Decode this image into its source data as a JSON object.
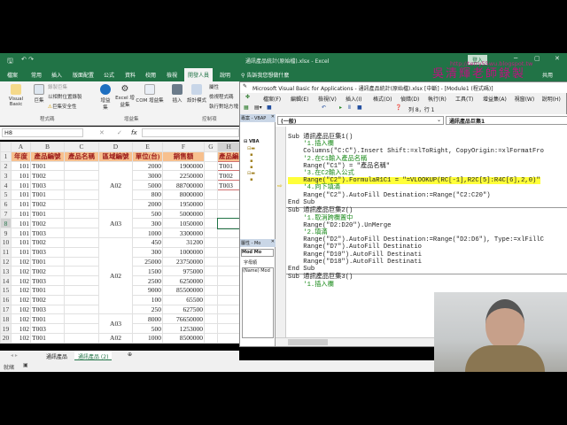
{
  "excel": {
    "title": "通訊產品統計(原始檔).xlsx - Excel",
    "signin": "登入",
    "share": "共用",
    "tabs": [
      "檔案",
      "常用",
      "插入",
      "版面配置",
      "公式",
      "資料",
      "校閱",
      "檢視",
      "開發人員",
      "說明"
    ],
    "active_tab": "開發人員",
    "tell_me": "告訴我您想做什麼",
    "ribbon": {
      "visual_basic": "Visual Basic",
      "macros": "巨集",
      "record_macro": "錄製巨集",
      "relative_ref": "以相對位置錄製",
      "macro_security": "巨集安全性",
      "group_code": "程式碼",
      "addins": "增益集",
      "excel_addins": "Excel 增益集",
      "com_addins": "COM 增益集",
      "group_addins": "增益集",
      "insert": "插入",
      "design_mode": "設計模式",
      "properties": "屬性",
      "view_code": "檢視程式碼",
      "run_dialog": "執行對話方塊",
      "group_controls": "控制項"
    },
    "name_box": "H8",
    "fx": "fx",
    "columns": [
      "A",
      "B",
      "C",
      "D",
      "E",
      "F",
      "G",
      "H"
    ],
    "headers": [
      "年度",
      "產品編號",
      "產品名稱",
      "區域編號",
      "單位(台)",
      "銷售額",
      "",
      "產品編"
    ],
    "rows": [
      [
        "101",
        "T001",
        "",
        2000,
        1900000,
        "T001"
      ],
      [
        "101",
        "T002",
        "",
        3000,
        2250000,
        "T002"
      ],
      [
        "101",
        "T003",
        "",
        5000,
        88700000,
        "T003"
      ],
      [
        "101",
        "T001",
        "",
        800,
        8000000,
        ""
      ],
      [
        "101",
        "T002",
        "",
        2000,
        1950000,
        ""
      ],
      [
        "101",
        "T001",
        "",
        500,
        5000000,
        ""
      ],
      [
        "101",
        "T002",
        "",
        300,
        1050000,
        ""
      ],
      [
        "101",
        "T003",
        "",
        1000,
        3300000,
        ""
      ],
      [
        "101",
        "T002",
        "",
        450,
        31200,
        ""
      ],
      [
        "101",
        "T003",
        "",
        300,
        1000000,
        ""
      ],
      [
        "102",
        "T001",
        "",
        25000,
        23750000,
        ""
      ],
      [
        "102",
        "T002",
        "",
        1500,
        975000,
        ""
      ],
      [
        "102",
        "T003",
        "",
        2500,
        6250000,
        ""
      ],
      [
        "102",
        "T001",
        "",
        9000,
        85500000,
        ""
      ],
      [
        "102",
        "T002",
        "",
        100,
        65500,
        ""
      ],
      [
        "102",
        "T003",
        "",
        250,
        627500,
        ""
      ],
      [
        "102",
        "T001",
        "",
        8000,
        76650000,
        ""
      ],
      [
        "102",
        "T003",
        "",
        500,
        1253000,
        ""
      ],
      [
        "102",
        "T001",
        "",
        1000,
        8500000,
        ""
      ]
    ],
    "regions": [
      {
        "label": "A02",
        "span": 5
      },
      {
        "label": "A03",
        "span": 3
      },
      {
        "label": "A02",
        "span": 8
      },
      {
        "label": "A03",
        "span": 2
      },
      {
        "label": "A02",
        "span": 1
      }
    ],
    "sheets": [
      "通訊產品",
      "通訊產品 (2)"
    ],
    "active_sheet": "通訊產品 (2)",
    "status": "就緒"
  },
  "vbe": {
    "title": "Microsoft Visual Basic for Applications - 通訊產品統計(原始檔).xlsx [中斷] - [Module1 (程式碼)]",
    "menu": [
      "檔案(F)",
      "編輯(E)",
      "檢視(V)",
      "插入(I)",
      "格式(O)",
      "偵錯(D)",
      "執行(R)",
      "工具(T)",
      "增益集(A)",
      "視窗(W)",
      "說明(H)"
    ],
    "position": "列 8，行 1",
    "object_combo": "(一般)",
    "proc_combo": "通訊產品巨集1",
    "project_title": "專案 - VBAP",
    "project_root": "VBA",
    "props_title": "屬性 - Mo",
    "props_combo": "Mod Mo",
    "props_tab": "字母順",
    "props_name": "(Name) Mod",
    "code": [
      {
        "t": "Sub 通訊產品巨集1()",
        "c": ""
      },
      {
        "t": "    '1.插入欄",
        "c": "cm"
      },
      {
        "t": "    Columns(\"C:C\").Insert Shift:=xlToRight, CopyOrigin:=xlFormatFro",
        "c": ""
      },
      {
        "t": "    '2.在C1輸入產品名稱",
        "c": "cm"
      },
      {
        "t": "    Range(\"C1\") = \"產品名稱\"",
        "c": ""
      },
      {
        "t": "    '3.在C2輸入公式",
        "c": "cm"
      },
      {
        "t": "    Range(\"C2\").FormulaR1C1 = \"=VLOOKUP(RC[-1],R2C[5]:R4C[6],2,0)\"",
        "c": "hl"
      },
      {
        "t": "    '4.向下填滿",
        "c": "cm"
      },
      {
        "t": "    Range(\"C2\").AutoFill Destination:=Range(\"C2:C20\")",
        "c": ""
      },
      {
        "t": "End Sub",
        "c": ""
      },
      {
        "t": "Sub 通訊產品巨集2()",
        "c": ""
      },
      {
        "t": "    '1.取消跨欄置中",
        "c": "cm"
      },
      {
        "t": "    Range(\"D2:D20\").UnMerge",
        "c": ""
      },
      {
        "t": "    '2.填滿",
        "c": "cm"
      },
      {
        "t": "    Range(\"D2\").AutoFill Destination:=Range(\"D2:D6\"), Type:=xlFillC",
        "c": ""
      },
      {
        "t": "    Range(\"D7\").AutoFill Destinatio",
        "c": ""
      },
      {
        "t": "    Range(\"D10\").AutoFill Destinati",
        "c": ""
      },
      {
        "t": "    Range(\"D18\").AutoFill Destinati",
        "c": ""
      },
      {
        "t": "End Sub",
        "c": ""
      },
      {
        "t": "Sub 通訊產品巨集3()",
        "c": ""
      },
      {
        "t": "    '1.插入欄",
        "c": "cm"
      }
    ]
  },
  "watermark": {
    "url": "http://terry55wu.blogspot.tw",
    "text": "吳清輝老師錄製"
  }
}
